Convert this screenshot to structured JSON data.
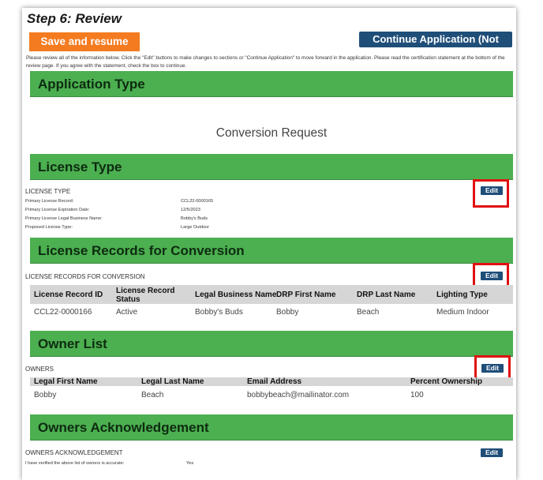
{
  "step_title": "Step 6: Review",
  "buttons": {
    "save_resume": "Save and resume later",
    "continue_app": "Continue Application (Not Saved)",
    "edit": "Edit"
  },
  "instructions": "Please review all of the information below. Click the \"Edit\" buttons to make changes to sections or \"Continue Application\" to move forward in the application. Please read the certification statement at the bottom of the review page. If you agree with the statement, check the box to continue.",
  "application_type": {
    "header": "Application Type",
    "value": "Conversion Request"
  },
  "license_type": {
    "header": "License Type",
    "sub": "LICENSE TYPE",
    "fields": [
      {
        "label": "Primary License Record:",
        "value": "CCL22-0000165"
      },
      {
        "label": "Primary License Expiration Date:",
        "value": "12/5/2023"
      },
      {
        "label": "Primary License Legal Business Name:",
        "value": "Bobby's Buds"
      },
      {
        "label": "Proposed License Type:",
        "value": "Large Outdoor"
      }
    ]
  },
  "license_records": {
    "header": "License Records for Conversion",
    "sub": "LICENSE RECORDS FOR CONVERSION",
    "columns": [
      "License Record ID",
      "License Record Status",
      "Legal Business Name",
      "DRP First Name",
      "DRP Last Name",
      "Lighting Type"
    ],
    "rows": [
      [
        "CCL22-0000166",
        "Active",
        "Bobby's Buds",
        "Bobby",
        "Beach",
        "Medium Indoor"
      ]
    ]
  },
  "owner_list": {
    "header": "Owner List",
    "sub": "OWNERS",
    "columns": [
      "Legal First Name",
      "Legal Last Name",
      "Email Address",
      "Percent Ownership"
    ],
    "rows": [
      [
        "Bobby",
        "Beach",
        "bobbybeach@mailinator.com",
        "100"
      ]
    ]
  },
  "owners_ack": {
    "header": "Owners Acknowledgement",
    "sub": "OWNERS ACKNOWLEDGEMENT",
    "fields": [
      {
        "label": "I have verified the above list of owners is accurate:",
        "value": "Yes"
      }
    ]
  },
  "colors": {
    "accent_orange": "#f47b20",
    "accent_navy": "#1f4e79",
    "section_green": "#4caf50",
    "highlight_red": "#e01010"
  }
}
